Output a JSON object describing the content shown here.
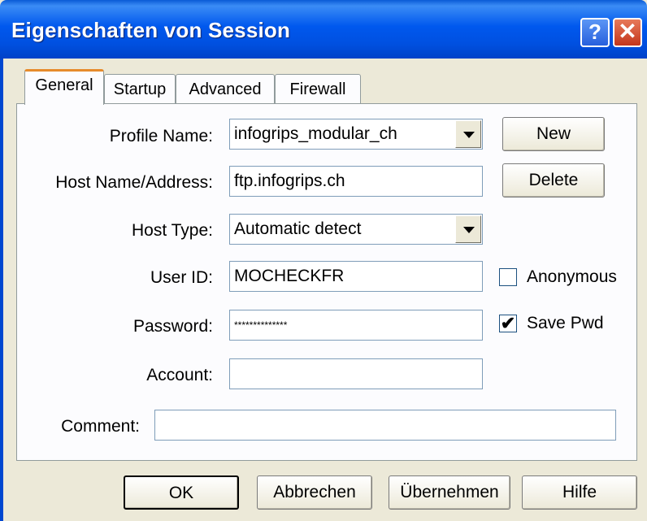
{
  "window": {
    "title": "Eigenschaften von Session",
    "help_glyph": "?",
    "close_glyph": "✕"
  },
  "tabs": [
    {
      "label": "General",
      "active": true
    },
    {
      "label": "Startup",
      "active": false
    },
    {
      "label": "Advanced",
      "active": false
    },
    {
      "label": "Firewall",
      "active": false
    }
  ],
  "form": {
    "profile_name": {
      "label": "Profile Name:",
      "value": "infogrips_modular_ch"
    },
    "host_name": {
      "label": "Host Name/Address:",
      "value": "ftp.infogrips.ch"
    },
    "host_type": {
      "label": "Host Type:",
      "value": "Automatic detect"
    },
    "user_id": {
      "label": "User ID:",
      "value": "MOCHECKFR"
    },
    "password": {
      "label": "Password:",
      "value": "**************"
    },
    "account": {
      "label": "Account:",
      "value": ""
    },
    "comment": {
      "label": "Comment:",
      "value": ""
    },
    "anonymous": {
      "label": "Anonymous",
      "checked": false
    },
    "save_pwd": {
      "label": "Save Pwd",
      "checked": true,
      "mark": "✔"
    }
  },
  "side_buttons": {
    "new": "New",
    "delete": "Delete"
  },
  "footer_buttons": {
    "ok": "OK",
    "cancel": "Abbrechen",
    "apply": "Übernehmen",
    "help": "Hilfe"
  }
}
